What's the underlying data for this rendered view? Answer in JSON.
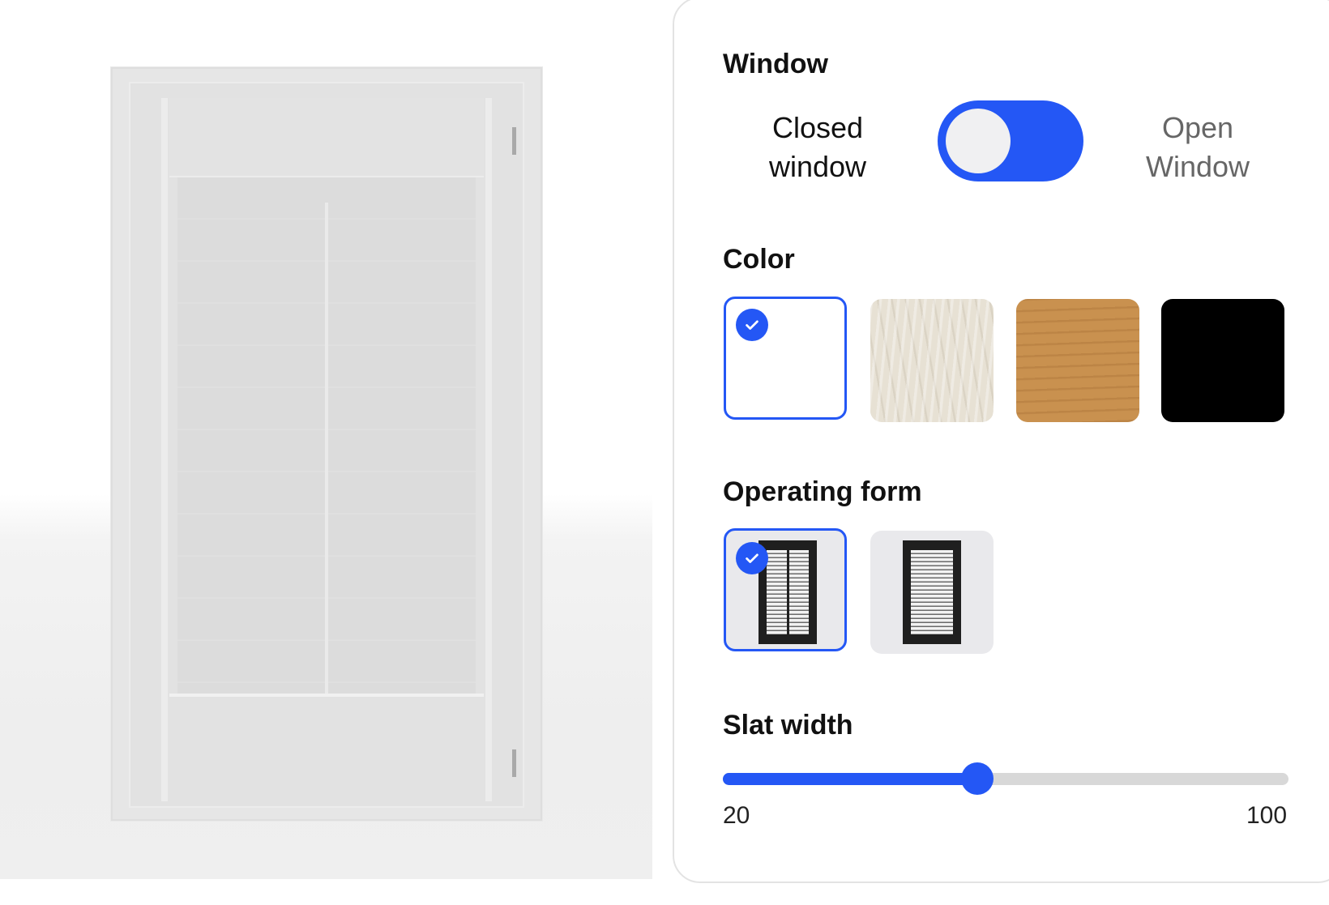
{
  "preview": {
    "icon": "window-shutter-3d-preview"
  },
  "window": {
    "title": "Window",
    "closed_label": "Closed\nwindow",
    "open_label": "Open\nWindow",
    "toggle_state": "closed"
  },
  "color": {
    "title": "Color",
    "options": [
      {
        "name": "white",
        "hex": "#ffffff",
        "selected": true
      },
      {
        "name": "birch",
        "hex": "#e7e1d4",
        "selected": false
      },
      {
        "name": "oak",
        "hex": "#c9914f",
        "selected": false
      },
      {
        "name": "black",
        "hex": "#000000",
        "selected": false
      }
    ]
  },
  "operating_form": {
    "title": "Operating form",
    "options": [
      {
        "name": "split-tilt-rod",
        "selected": true
      },
      {
        "name": "single-panel",
        "selected": false
      }
    ]
  },
  "slat_width": {
    "title": "Slat width",
    "min": "20",
    "max": "100",
    "value": 56
  },
  "colors": {
    "accent": "#2457f5",
    "track": "#d8d8d8"
  }
}
